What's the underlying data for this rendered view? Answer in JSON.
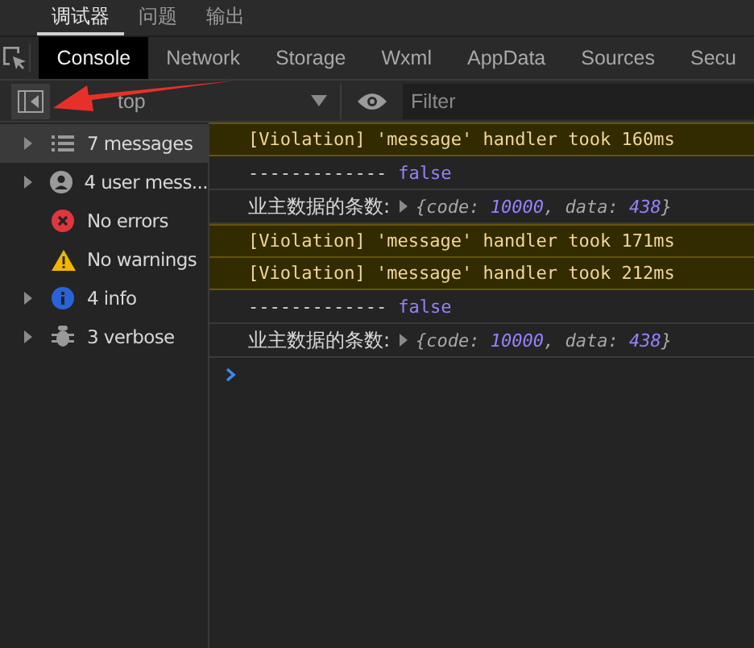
{
  "panel_tabs": [
    {
      "label": "调试器",
      "selected": true
    },
    {
      "label": "问题",
      "selected": false
    },
    {
      "label": "输出",
      "selected": false
    }
  ],
  "devtools_tabs": [
    {
      "label": "Console",
      "selected": true
    },
    {
      "label": "Network",
      "selected": false
    },
    {
      "label": "Storage",
      "selected": false
    },
    {
      "label": "Wxml",
      "selected": false
    },
    {
      "label": "AppData",
      "selected": false
    },
    {
      "label": "Sources",
      "selected": false
    },
    {
      "label": "Secu",
      "selected": false
    }
  ],
  "toolbar": {
    "context": "top",
    "filter": {
      "placeholder": "Filter"
    }
  },
  "sidebar": {
    "items": [
      {
        "label": "7 messages",
        "kind": "list",
        "expanded": false,
        "selected": true
      },
      {
        "label": "4 user mess...",
        "kind": "user",
        "expanded": false,
        "selected": false
      },
      {
        "label": "No errors",
        "kind": "error",
        "selected": false
      },
      {
        "label": "No warnings",
        "kind": "warning",
        "selected": false
      },
      {
        "label": "4 info",
        "kind": "info",
        "expanded": false,
        "selected": false
      },
      {
        "label": "3 verbose",
        "kind": "bug",
        "expanded": false,
        "selected": false
      }
    ]
  },
  "messages": [
    {
      "kind": "violation",
      "text": "[Violation] 'message' handler took 160ms"
    },
    {
      "kind": "value",
      "text": "-------------",
      "value": "false"
    },
    {
      "kind": "object",
      "text": "业主数据的条数:",
      "expanded": false,
      "preview": [
        {
          "kind": "key",
          "text": "{code: "
        },
        {
          "kind": "number",
          "text": "10000"
        },
        {
          "kind": "key",
          "text": ", data: "
        },
        {
          "kind": "number",
          "text": "438"
        },
        {
          "kind": "key",
          "text": "}"
        }
      ]
    },
    {
      "kind": "violation",
      "text": "[Violation] 'message' handler took 171ms"
    },
    {
      "kind": "violation",
      "text": "[Violation] 'message' handler took 212ms"
    },
    {
      "kind": "value",
      "text": "-------------",
      "value": "false"
    },
    {
      "kind": "object",
      "text": "业主数据的条数:",
      "expanded": false,
      "preview": [
        {
          "kind": "key",
          "text": "{code: "
        },
        {
          "kind": "number",
          "text": "10000"
        },
        {
          "kind": "key",
          "text": ", data: "
        },
        {
          "kind": "number",
          "text": "438"
        },
        {
          "kind": "key",
          "text": "}"
        }
      ]
    }
  ]
}
